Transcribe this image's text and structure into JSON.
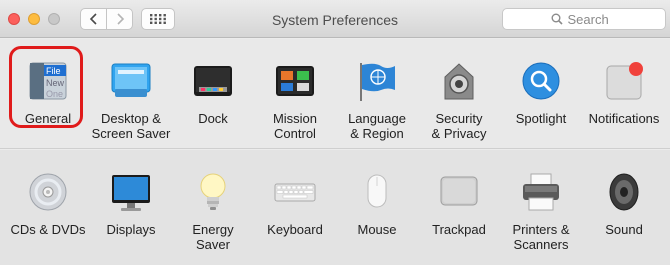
{
  "window": {
    "title": "System Preferences",
    "back_icon": "chevron-left-icon",
    "forward_icon": "chevron-right-icon",
    "grid_icon": "grid-icon"
  },
  "search": {
    "placeholder": "Search",
    "icon": "search-icon"
  },
  "highlight": {
    "target": "General",
    "color": "#e01b1b"
  },
  "rows": [
    {
      "items": [
        {
          "label": "General",
          "icon": "general-icon"
        },
        {
          "label": "Desktop &\nScreen Saver",
          "icon": "desktop-screen-saver-icon"
        },
        {
          "label": "Dock",
          "icon": "dock-icon"
        },
        {
          "label": "Mission\nControl",
          "icon": "mission-control-icon"
        },
        {
          "label": "Language\n& Region",
          "icon": "language-region-icon"
        },
        {
          "label": "Security\n& Privacy",
          "icon": "security-privacy-icon"
        },
        {
          "label": "Spotlight",
          "icon": "spotlight-icon"
        },
        {
          "label": "Notifications",
          "icon": "notifications-icon"
        }
      ]
    },
    {
      "items": [
        {
          "label": "CDs & DVDs",
          "icon": "cds-dvds-icon"
        },
        {
          "label": "Displays",
          "icon": "displays-icon"
        },
        {
          "label": "Energy\nSaver",
          "icon": "energy-saver-icon"
        },
        {
          "label": "Keyboard",
          "icon": "keyboard-icon"
        },
        {
          "label": "Mouse",
          "icon": "mouse-icon"
        },
        {
          "label": "Trackpad",
          "icon": "trackpad-icon"
        },
        {
          "label": "Printers &\nScanners",
          "icon": "printers-scanners-icon"
        },
        {
          "label": "Sound",
          "icon": "sound-icon"
        }
      ]
    }
  ],
  "general_icon_text": [
    "File",
    "New",
    "One"
  ]
}
